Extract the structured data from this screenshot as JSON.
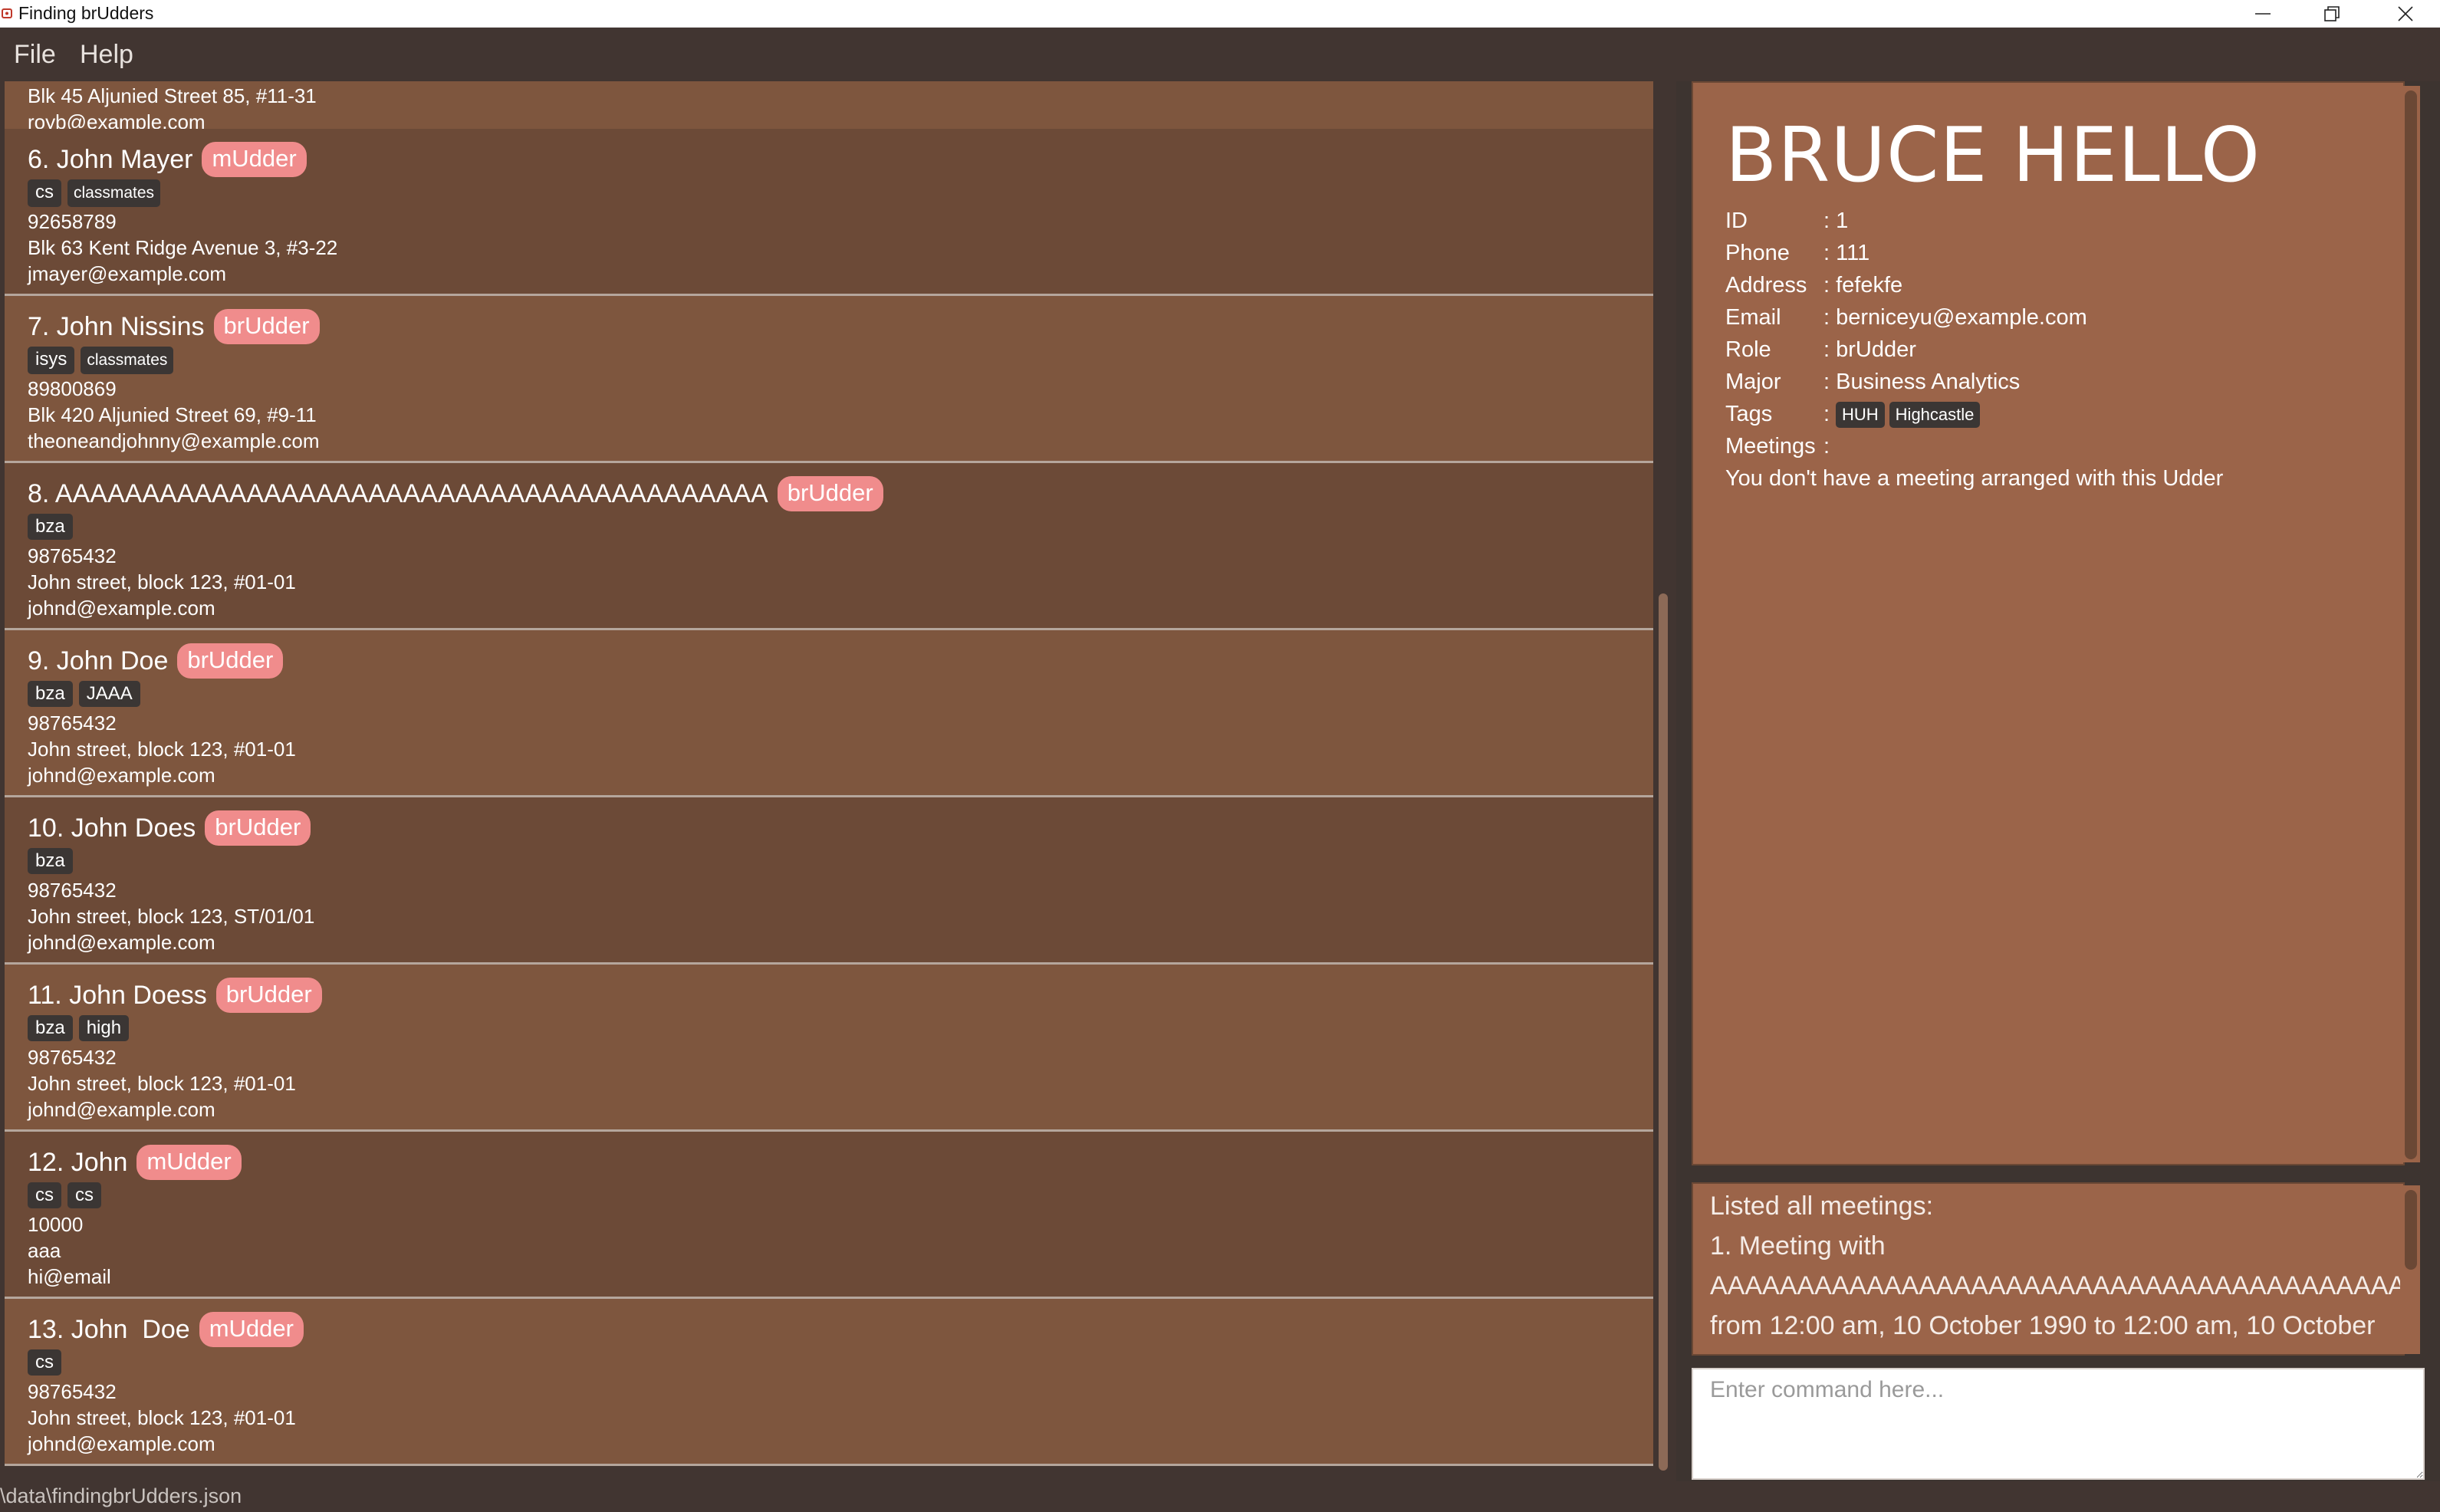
{
  "window": {
    "title": "Finding brUdders",
    "icon": "app-icon"
  },
  "menu": {
    "items": [
      "File",
      "Help"
    ]
  },
  "list": {
    "partial_top": {
      "address": "Blk 45 Aljunied Street 85, #11-31",
      "email": "royb@example.com"
    },
    "cards": [
      {
        "name": "6. John Mayer",
        "role": "mUdder",
        "tags": [
          "cs",
          "classmates"
        ],
        "phone": "92658789",
        "address": "Blk 63 Kent Ridge Avenue 3, #3-22",
        "email": "jmayer@example.com"
      },
      {
        "name": "7. John Nissins",
        "role": "brUdder",
        "tags": [
          "isys",
          "classmates"
        ],
        "phone": "89800869",
        "address": "Blk 420 Aljunied Street 69, #9-11",
        "email": "theoneandjohnny@example.com"
      },
      {
        "name": "8. AAAAAAAAAAAAAAAAAAAAAAAAAAAAAAAAAAAAAAAAA",
        "role": "brUdder",
        "tags": [
          "bza"
        ],
        "phone": "98765432",
        "address": "John street, block 123, #01-01",
        "email": "johnd@example.com"
      },
      {
        "name": "9. John Doe",
        "role": "brUdder",
        "tags": [
          "bza",
          "JAAA"
        ],
        "phone": "98765432",
        "address": "John street, block 123, #01-01",
        "email": "johnd@example.com"
      },
      {
        "name": "10. John Does",
        "role": "brUdder",
        "tags": [
          "bza"
        ],
        "phone": "98765432",
        "address": "John street, block 123, ST/01/01",
        "email": "johnd@example.com"
      },
      {
        "name": "11. John Doess",
        "role": "brUdder",
        "tags": [
          "bza",
          "high"
        ],
        "phone": "98765432",
        "address": "John street, block 123, #01-01",
        "email": "johnd@example.com"
      },
      {
        "name": "12. John",
        "role": "mUdder",
        "tags": [
          "cs",
          "cs"
        ],
        "phone": "10000",
        "address": "aaa",
        "email": "hi@email"
      },
      {
        "name": "13. John  Doe",
        "role": "mUdder",
        "tags": [
          "cs"
        ],
        "phone": "98765432",
        "address": "John street, block 123, #01-01",
        "email": "johnd@example.com"
      }
    ]
  },
  "detail": {
    "name": "BRUCE HELLO",
    "fields": [
      {
        "label": "ID",
        "value": ": 1"
      },
      {
        "label": "Phone",
        "value": ": 111"
      },
      {
        "label": "Address",
        "value": ": fefekfe"
      },
      {
        "label": "Email",
        "value": ": berniceyu@example.com"
      },
      {
        "label": "Role",
        "value": ": brUdder"
      },
      {
        "label": "Major",
        "value": ": Business Analytics"
      }
    ],
    "tags_label": "Tags",
    "tags_colon": ":",
    "tags": [
      "HUH",
      "Highcastle"
    ],
    "meetings_label": "Meetings",
    "meetings_colon": ":",
    "meetings_text": "You don't have a meeting arranged with this Udder"
  },
  "result": {
    "lines": [
      "Listed all meetings:",
      "1. Meeting with",
      "AAAAAAAAAAAAAAAAAAAAAAAAAAAAAAAAAAAAAAAA",
      "from 12:00 am, 10 October 1990 to 12:00 am, 10 October"
    ]
  },
  "command": {
    "placeholder": "Enter command here..."
  },
  "status": {
    "path": "\\data\\findingbrUdders.json"
  },
  "colors": {
    "card_odd": "#6c4a37",
    "card_even": "#7e563e",
    "role_badge": "#f08c8c",
    "detail_bg": "#9b6449",
    "menubar_bg": "#413531"
  }
}
